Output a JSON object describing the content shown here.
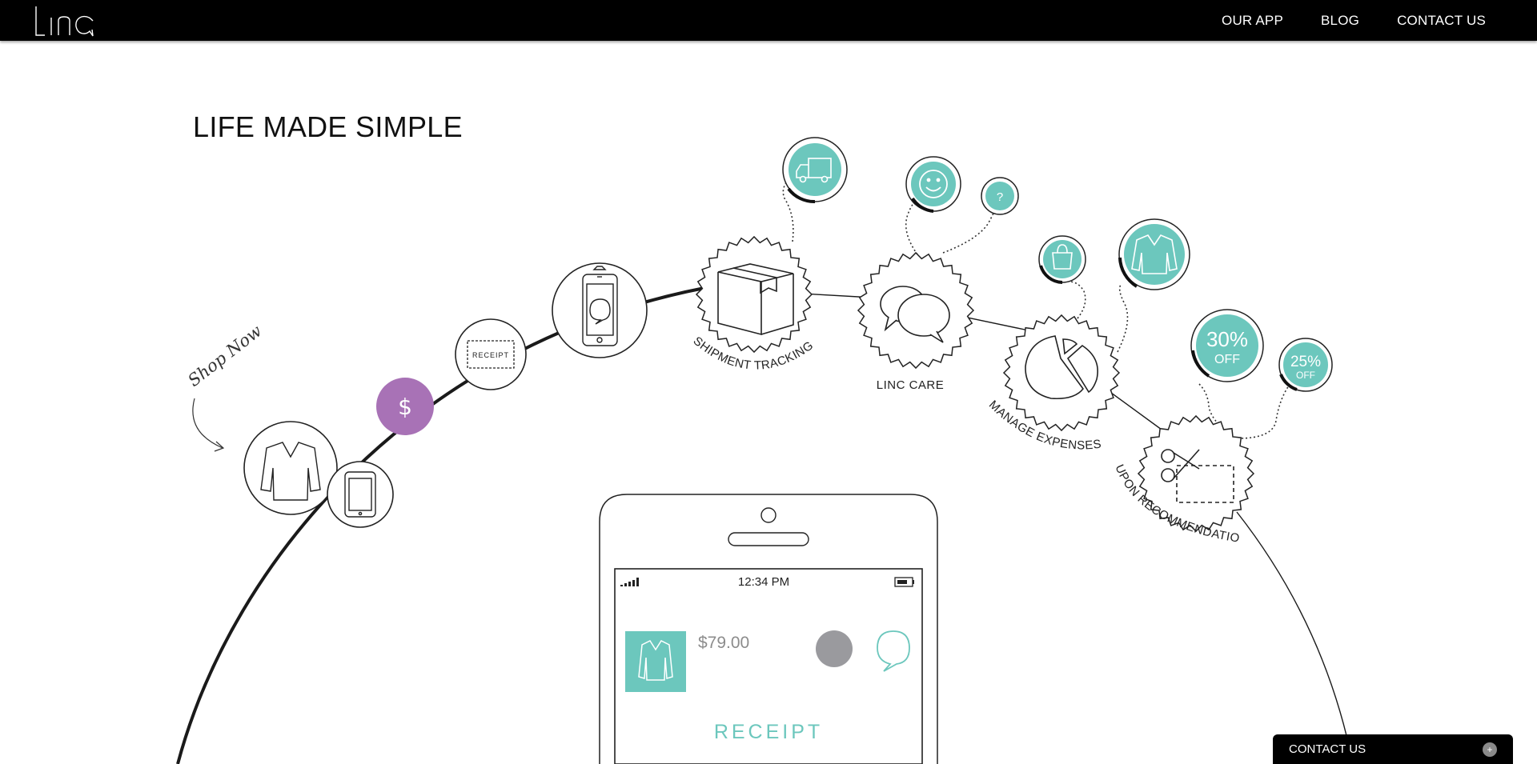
{
  "nav": {
    "items": [
      {
        "label": "OUR APP"
      },
      {
        "label": "BLOG"
      },
      {
        "label": "CONTACT US"
      }
    ]
  },
  "hero": {
    "title": "LIFE MADE SIMPLE",
    "shop_now": "Shop Now"
  },
  "journey": {
    "receipt_tag": "RECEIPT",
    "dollar": "$",
    "labels": {
      "shipment": "SHIPMENT TRACKING",
      "care": "LINC CARE",
      "expenses": "MANAGE EXPENSES",
      "coupons": "COUPON RECOMMENDATIONS"
    },
    "help_glyph": "?",
    "coupons": [
      {
        "percent": "30%",
        "suffix": "OFF"
      },
      {
        "percent": "25%",
        "suffix": "OFF"
      }
    ]
  },
  "phone": {
    "time": "12:34 PM",
    "price": "$79.00",
    "receipt_label": "RECEIPT"
  },
  "contact_tab": {
    "label": "CONTACT US",
    "icon": "+"
  },
  "colors": {
    "teal": "#6cc7bd",
    "purple": "#a872b6",
    "nav_bg": "#000000",
    "gray_dot": "#9a9a9e"
  }
}
